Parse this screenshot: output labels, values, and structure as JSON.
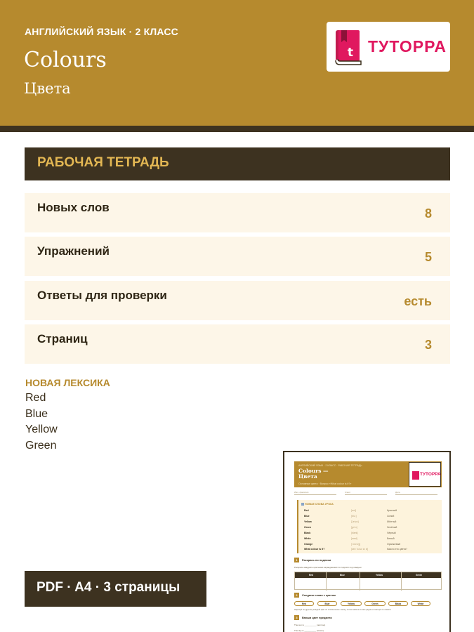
{
  "header": {
    "subject": "АНГЛИЙСКИЙ ЯЗЫК · 2 КЛАСС",
    "title_en": "Colours",
    "title_ru": "Цвета",
    "logo_text": "ТУТОРРА"
  },
  "colors": {
    "header_bg": "#b68a2e",
    "dark": "#3d3220",
    "accent_text": "#e3b753",
    "card_bg": "#fdf6e8",
    "logo_pink": "#e0185f"
  },
  "banner": {
    "label": "РАБОЧАЯ ТЕТРАДЬ"
  },
  "stats": [
    {
      "label": "Новых слов",
      "value": "8"
    },
    {
      "label": "Упражнений",
      "value": "5"
    },
    {
      "label": "Ответы для проверки",
      "value": "есть"
    },
    {
      "label": "Страниц",
      "value": "3"
    }
  ],
  "vocab": {
    "title": "НОВАЯ ЛЕКСИКА",
    "words": [
      "Red",
      "Blue",
      "Yellow",
      "Green"
    ]
  },
  "format_badge": "PDF · A4 · 3 страницы",
  "preview": {
    "subtitle": "АНГЛИЙСКИЙ ЯЗЫК · 2 КЛАСС · РАБОЧАЯ ТЕТРАДЬ",
    "title_line1": "Colours —",
    "title_line2": "Цвета",
    "tagline": "Основные цвета · Вопрос «What colour is it?»",
    "logo_text": "ТУТОРРА",
    "fields": [
      "Имя, фамилия",
      "Класс",
      "Дата"
    ],
    "vocab_title": "НОВЫЕ СЛОВА УРОКА",
    "vocab_rows": [
      {
        "word": "Red",
        "transcription": "[red]",
        "translation": "Красный"
      },
      {
        "word": "Blue",
        "transcription": "[bluː]",
        "translation": "Синий"
      },
      {
        "word": "Yellow",
        "transcription": "[ˈjeləʊ]",
        "translation": "Жёлтый"
      },
      {
        "word": "Green",
        "transcription": "[ɡriːn]",
        "translation": "Зелёный"
      },
      {
        "word": "Black",
        "transcription": "[blæk]",
        "translation": "Чёрный"
      },
      {
        "word": "White",
        "transcription": "[waɪt]",
        "translation": "Белый"
      },
      {
        "word": "Orange",
        "transcription": "[ˈɒrɪndʒ]",
        "translation": "Оранжевый"
      },
      {
        "word": "What colour is it?",
        "transcription": "[wɒt ˈkʌlər ɪz ɪt]",
        "translation": "Какого это цвета?"
      }
    ],
    "task1_num": "1",
    "task1_title": "Раскрась по подписи",
    "task1_text": "Раскрась квадраты цветными карандашами по подписи под каждым",
    "table_headers": [
      "Red",
      "Blue",
      "Yellow",
      "Green"
    ],
    "task2_num": "2",
    "task2_title": "Соедини слово с цветом",
    "chips": [
      "Red",
      "Blue",
      "Yellow",
      "Green",
      "Black",
      "White"
    ],
    "task2_text": "Нарисуй по-другому каждый цвет из списка выше: внизу, потом запиши слово рядом и повтори по памяти",
    "task3_num": "3",
    "task3_title": "Впиши цвет предмета",
    "task3_line1": "The sun is __________ (жёлтое)",
    "task3_line2": "The sky is __________ (синее)"
  }
}
